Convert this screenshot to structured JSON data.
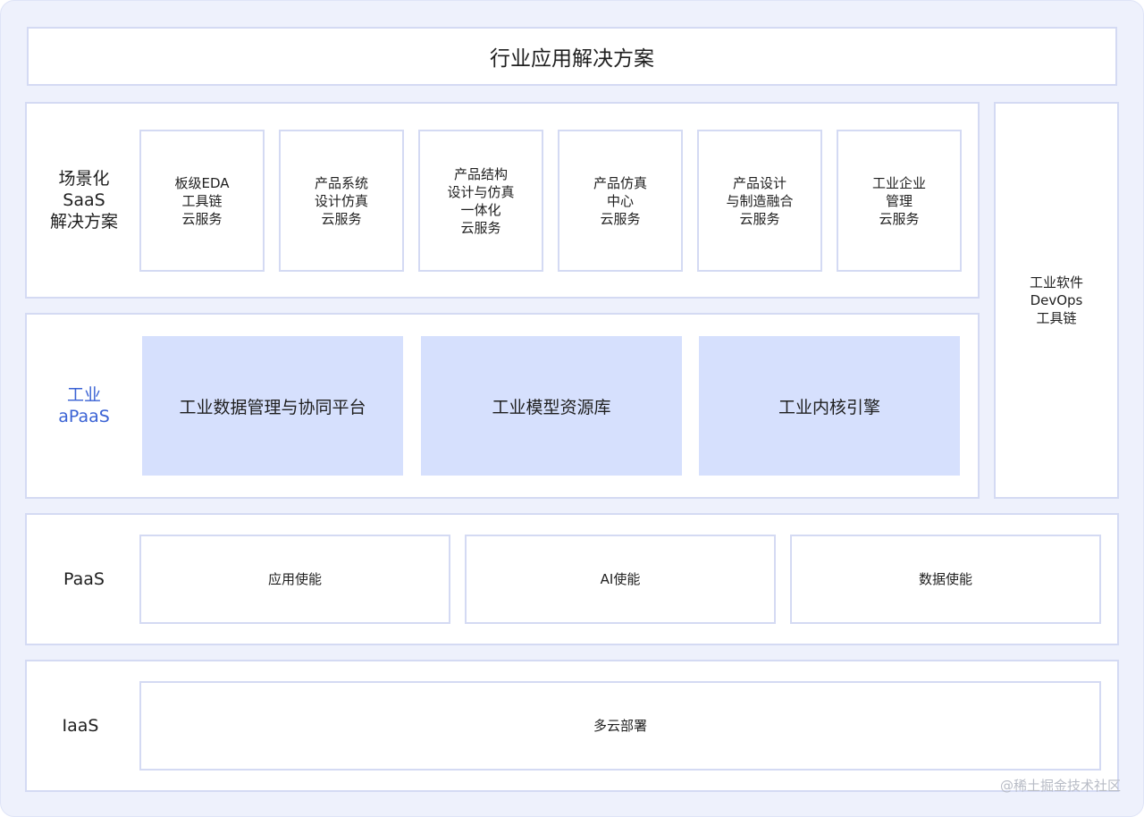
{
  "top_banner": "行业应用解决方案",
  "saas": {
    "label": "场景化\nSaaS\n解决方案",
    "cards": [
      "板级EDA\n工具链\n云服务",
      "产品系统\n设计仿真\n云服务",
      "产品结构\n设计与仿真\n一体化\n云服务",
      "产品仿真\n中心\n云服务",
      "产品设计\n与制造融合\n云服务",
      "工业企业\n管理\n云服务"
    ]
  },
  "apaas": {
    "label": "工业\naPaaS",
    "label_color": "#3a62d4",
    "cards": [
      "工业数据管理与协同平台",
      "工业模型资源库",
      "工业内核引擎"
    ],
    "card_color": "#d6e0fd"
  },
  "devops": {
    "label": "工业软件\nDevOps\n工具链"
  },
  "paas": {
    "label": "PaaS",
    "cards": [
      "应用使能",
      "AI使能",
      "数据使能"
    ]
  },
  "iaas": {
    "label": "IaaS",
    "card": "多云部署"
  },
  "watermark": "@稀土掘金技术社区",
  "colors": {
    "background": "#eef1fc",
    "border": "#d4daf3",
    "accent": "#3a62d4"
  }
}
